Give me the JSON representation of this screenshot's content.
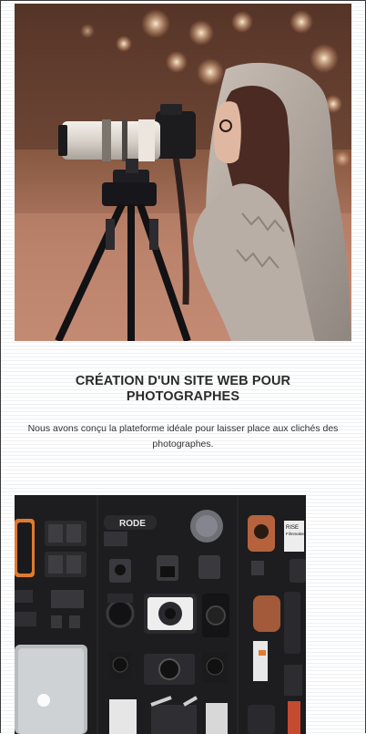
{
  "project": {
    "title": "CRÉATION D'UN SITE WEB POUR PHOTOGRAPHES",
    "description": "Nous avons conçu la plateforme idéale pour laisser place aux clichés des photographes.",
    "image_icon": "photographer-with-camera-tripod-photo"
  },
  "next_project": {
    "image_icon": "camera-gear-flatlay-photo",
    "gear_label": "RODE",
    "box_label_1": "RISE",
    "box_label_2": "Filmmaker"
  },
  "colors": {
    "title": "#2b2b2b",
    "text": "#333333",
    "border": "#3a3a3a"
  }
}
